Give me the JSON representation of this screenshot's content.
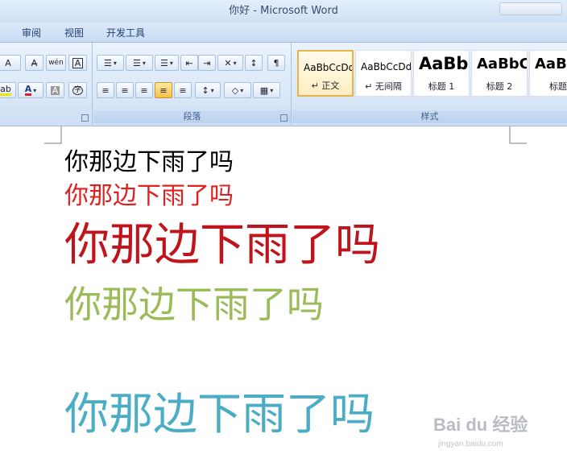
{
  "window": {
    "title": "你好 - Microsoft Word"
  },
  "tabs": [
    "审阅",
    "视图",
    "开发工具"
  ],
  "ribbon": {
    "font_group": {
      "row1": [
        {
          "icon": "grow-font-icon",
          "glyph": "A"
        },
        {
          "icon": "shrink-font-icon",
          "glyph": "A"
        },
        {
          "icon": "clear-format-icon",
          "glyph": "A̶"
        },
        {
          "icon": "phonetic-guide-icon",
          "glyph": "wén"
        },
        {
          "icon": "char-border-icon",
          "glyph": "A"
        }
      ],
      "row2": [
        {
          "icon": "highlight-icon",
          "glyph": "ab"
        },
        {
          "icon": "font-color-icon",
          "glyph": "A"
        },
        {
          "icon": "char-shading-icon",
          "glyph": "A"
        },
        {
          "icon": "enclosed-char-icon",
          "glyph": "字"
        }
      ]
    },
    "paragraph_group": {
      "label": "段落",
      "row1": [
        {
          "icon": "bullets-icon",
          "glyph": "☰"
        },
        {
          "icon": "numbering-icon",
          "glyph": "☰"
        },
        {
          "icon": "multilevel-list-icon",
          "glyph": "☰"
        },
        {
          "icon": "decrease-indent-icon",
          "glyph": "⇤"
        },
        {
          "icon": "increase-indent-icon",
          "glyph": "⇥"
        },
        {
          "icon": "chinese-layout-icon",
          "glyph": "✕"
        },
        {
          "icon": "sort-icon",
          "glyph": "↕"
        },
        {
          "icon": "show-marks-icon",
          "glyph": "¶"
        }
      ],
      "row2": [
        {
          "icon": "align-left-icon",
          "glyph": "≡"
        },
        {
          "icon": "align-center-icon",
          "glyph": "≡"
        },
        {
          "icon": "align-right-icon",
          "glyph": "≡"
        },
        {
          "icon": "justify-icon",
          "glyph": "≡"
        },
        {
          "icon": "distributed-icon",
          "glyph": "≡"
        },
        {
          "icon": "line-spacing-icon",
          "glyph": "↕"
        },
        {
          "icon": "shading-icon",
          "glyph": "◇"
        },
        {
          "icon": "borders-icon",
          "glyph": "▦"
        }
      ]
    },
    "styles_group": {
      "label": "样式",
      "items": [
        {
          "sample": "AaBbCcDd",
          "name": "↵ 正文",
          "selected": true
        },
        {
          "sample": "AaBbCcDd",
          "name": "↵ 无间隔",
          "selected": false
        },
        {
          "sample": "AaBb",
          "name": "标题 1",
          "selected": false
        },
        {
          "sample": "AaBbC",
          "name": "标题 2",
          "selected": false
        },
        {
          "sample": "AaBl",
          "name": "标题",
          "selected": false
        }
      ]
    }
  },
  "document": {
    "lines": [
      {
        "text": "你那边下雨了吗",
        "color": "#000000"
      },
      {
        "text": "你那边下雨了吗",
        "color": "#e02020"
      },
      {
        "text": "你那边下雨了吗",
        "color": "#c0141c"
      },
      {
        "text": "你那边下雨了吗",
        "color": "#9bbb59"
      },
      {
        "text": "你那边下雨了吗",
        "color": "#4bacc6"
      }
    ]
  },
  "watermark": {
    "logo": "Bai du 经验",
    "url": "jingyan.baidu.com"
  }
}
